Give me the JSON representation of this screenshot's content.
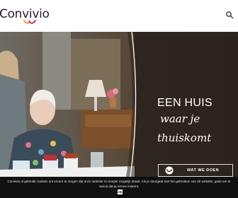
{
  "header": {
    "logo_text": "Convivio",
    "search_icon": "search-icon"
  },
  "hero": {
    "title": "EEN HUIS",
    "tagline_line1": "waar je",
    "tagline_line2": "thuiskomt",
    "cta_label": "WAT WE DOEN",
    "cta_icon": "convivio-mark-icon"
  },
  "cookie_bar": {
    "text": "Convivio.nl gebruikt cookies om ervoor te zorgen dat onze website zo soepel mogelijk draait. Als je doorgaat met het gebruiken van de website, gaan we er vanuit dat je ermee instemt.",
    "ok_label": "Ok"
  },
  "colors": {
    "brand_dark": "#2a1a3a",
    "brand_orange": "#f0a020",
    "brand_pink": "#d4307a",
    "cookie_bg": "#111111"
  }
}
